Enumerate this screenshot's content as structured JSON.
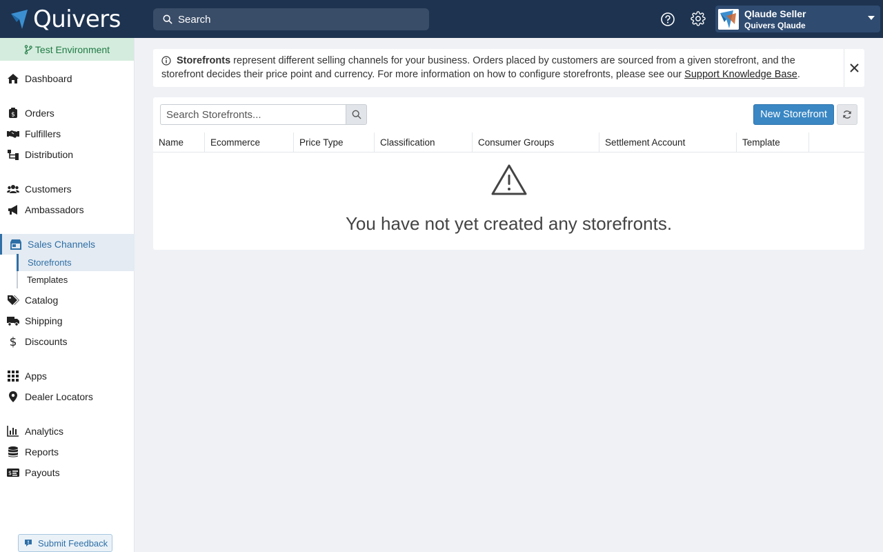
{
  "topbar": {
    "brand": "Quivers",
    "search_placeholder": "Search",
    "user_name": "Qlaude Seller",
    "user_company": "Quivers Qlaude"
  },
  "sidebar": {
    "environment": "Test Environment",
    "items": [
      {
        "label": "Dashboard",
        "icon": "home-icon"
      },
      {
        "label": "Orders",
        "icon": "orders-icon"
      },
      {
        "label": "Fulfillers",
        "icon": "handshake-icon"
      },
      {
        "label": "Distribution",
        "icon": "network-icon"
      },
      {
        "label": "Customers",
        "icon": "users-icon"
      },
      {
        "label": "Ambassadors",
        "icon": "megaphone-icon"
      },
      {
        "label": "Sales Channels",
        "icon": "store-icon"
      },
      {
        "label": "Catalog",
        "icon": "tags-icon"
      },
      {
        "label": "Shipping",
        "icon": "truck-icon"
      },
      {
        "label": "Discounts",
        "icon": "dollar-icon"
      },
      {
        "label": "Apps",
        "icon": "grid-icon"
      },
      {
        "label": "Dealer Locators",
        "icon": "map-pin-icon"
      },
      {
        "label": "Analytics",
        "icon": "bar-chart-icon"
      },
      {
        "label": "Reports",
        "icon": "database-icon"
      },
      {
        "label": "Payouts",
        "icon": "money-check-icon"
      }
    ],
    "subitems": [
      "Storefronts",
      "Templates"
    ],
    "feedback_label": "Submit Feedback"
  },
  "alert": {
    "bold": "Storefronts",
    "text": " represent different selling channels for your business. Orders placed by customers are sourced from a given storefront, and the storefront decides their price point and currency. For more information on how to configure storefronts, please see our ",
    "link": "Support Knowledge Base",
    "end": "."
  },
  "storefronts": {
    "search_placeholder": "Search Storefronts...",
    "new_label": "New Storefront",
    "columns": [
      "Name",
      "Ecommerce",
      "Price Type",
      "Classification",
      "Consumer Groups",
      "Settlement Account",
      "Template"
    ],
    "empty_message": "You have not yet created any storefronts."
  },
  "colors": {
    "topbar": "#1d3350",
    "accent": "#3a87c4",
    "env_bg": "#d4ecdd",
    "env_text": "#1f7a45"
  }
}
